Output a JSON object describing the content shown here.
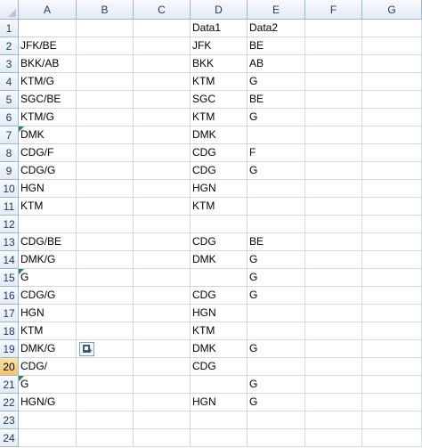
{
  "columns": [
    "A",
    "B",
    "C",
    "D",
    "E",
    "F",
    "G"
  ],
  "rows": [
    [
      "",
      "",
      "",
      "Data1",
      "Data2",
      "",
      ""
    ],
    [
      "JFK/BE",
      "",
      "",
      "JFK",
      "BE",
      "",
      ""
    ],
    [
      "BKK/AB",
      "",
      "",
      "BKK",
      "AB",
      "",
      ""
    ],
    [
      "KTM/G",
      "",
      "",
      "KTM",
      "G",
      "",
      ""
    ],
    [
      "SGC/BE",
      "",
      "",
      "SGC",
      "BE",
      "",
      ""
    ],
    [
      "KTM/G",
      "",
      "",
      "KTM",
      "G",
      "",
      ""
    ],
    [
      "DMK",
      "",
      "",
      "DMK",
      "",
      "",
      ""
    ],
    [
      "CDG/F",
      "",
      "",
      "CDG",
      "F",
      "",
      ""
    ],
    [
      "CDG/G",
      "",
      "",
      "CDG",
      "G",
      "",
      ""
    ],
    [
      "HGN",
      "",
      "",
      "HGN",
      "",
      "",
      ""
    ],
    [
      "KTM",
      "",
      "",
      "KTM",
      "",
      "",
      ""
    ],
    [
      "",
      "",
      "",
      "",
      "",
      "",
      ""
    ],
    [
      "CDG/BE",
      "",
      "",
      "CDG",
      "BE",
      "",
      ""
    ],
    [
      "DMK/G",
      "",
      "",
      "DMK",
      "G",
      "",
      ""
    ],
    [
      "G",
      "",
      "",
      "",
      "G",
      "",
      ""
    ],
    [
      "CDG/G",
      "",
      "",
      "CDG",
      "G",
      "",
      ""
    ],
    [
      "HGN",
      "",
      "",
      "HGN",
      "",
      "",
      ""
    ],
    [
      "KTM",
      "",
      "",
      "KTM",
      "",
      "",
      ""
    ],
    [
      "DMK/G",
      "",
      "",
      "DMK",
      "G",
      "",
      ""
    ],
    [
      "CDG/",
      "",
      "",
      "CDG",
      "",
      "",
      ""
    ],
    [
      "G",
      "",
      "",
      "",
      "G",
      "",
      ""
    ],
    [
      "HGN/G",
      "",
      "",
      "HGN",
      "G",
      "",
      ""
    ],
    [
      "",
      "",
      "",
      "",
      "",
      "",
      ""
    ],
    [
      "",
      "",
      "",
      "",
      "",
      "",
      ""
    ]
  ],
  "selected_row": 20,
  "error_indicator_cells": [
    "A7",
    "A15",
    "A21"
  ],
  "paste_options_icon": "paste-options-icon",
  "colors": {
    "header_border": "#9eb6ce",
    "gridline": "#d0d7e5",
    "selected_header": "#f3c46b",
    "error_indicator": "#1f8a3a"
  }
}
